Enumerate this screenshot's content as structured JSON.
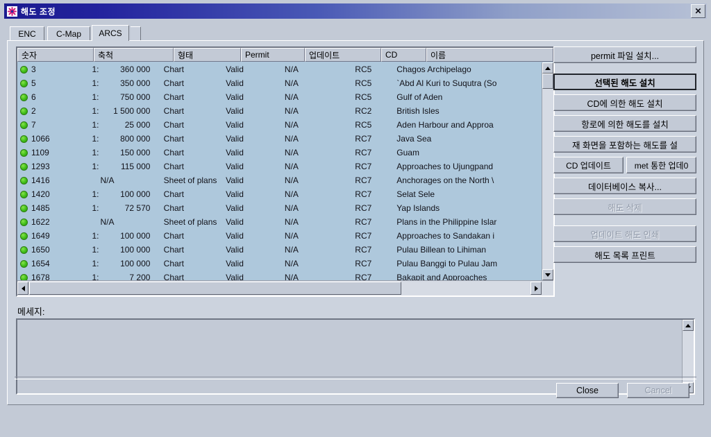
{
  "window": {
    "title": "해도 조정",
    "icon": "app-star-icon",
    "close_label": "✕",
    "titlebar_color": "#1b1b8f"
  },
  "tabs": [
    {
      "label": "ENC",
      "active": false
    },
    {
      "label": "C-Map",
      "active": false
    },
    {
      "label": "ARCS",
      "active": true
    }
  ],
  "table": {
    "columns": [
      {
        "label": "숫자"
      },
      {
        "label": "축척"
      },
      {
        "label": "형태"
      },
      {
        "label": "Permit"
      },
      {
        "label": "업데이트"
      },
      {
        "label": "CD"
      },
      {
        "label": "이름"
      }
    ],
    "rows": [
      {
        "status": "ok",
        "number": "3",
        "scale_ratio": "1:",
        "scale_value": "360 000",
        "type": "Chart",
        "permit": "Valid",
        "update": "N/A",
        "cd": "RC5",
        "name": "Chagos Archipelago"
      },
      {
        "status": "ok",
        "number": "5",
        "scale_ratio": "1:",
        "scale_value": "350 000",
        "type": "Chart",
        "permit": "Valid",
        "update": "N/A",
        "cd": "RC5",
        "name": "`Abd Al Kuri to Suqutra (So"
      },
      {
        "status": "ok",
        "number": "6",
        "scale_ratio": "1:",
        "scale_value": "750 000",
        "type": "Chart",
        "permit": "Valid",
        "update": "N/A",
        "cd": "RC5",
        "name": "Gulf of Aden"
      },
      {
        "status": "ok",
        "number": "2",
        "scale_ratio": "1:",
        "scale_value": "1 500 000",
        "type": "Chart",
        "permit": "Valid",
        "update": "N/A",
        "cd": "RC2",
        "name": "British Isles"
      },
      {
        "status": "ok",
        "number": "7",
        "scale_ratio": "1:",
        "scale_value": "25 000",
        "type": "Chart",
        "permit": "Valid",
        "update": "N/A",
        "cd": "RC5",
        "name": "Aden Harbour and Approa"
      },
      {
        "status": "ok",
        "number": "1066",
        "scale_ratio": "1:",
        "scale_value": "800 000",
        "type": "Chart",
        "permit": "Valid",
        "update": "N/A",
        "cd": "RC7",
        "name": "Java Sea"
      },
      {
        "status": "ok",
        "number": "1109",
        "scale_ratio": "1:",
        "scale_value": "150 000",
        "type": "Chart",
        "permit": "Valid",
        "update": "N/A",
        "cd": "RC7",
        "name": "Guam"
      },
      {
        "status": "ok",
        "number": "1293",
        "scale_ratio": "1:",
        "scale_value": "115 000",
        "type": "Chart",
        "permit": "Valid",
        "update": "N/A",
        "cd": "RC7",
        "name": "Approaches to Ujungpand"
      },
      {
        "status": "ok",
        "number": "1416",
        "scale_ratio": "",
        "scale_value": "N/A",
        "type": "Sheet of plans",
        "permit": "Valid",
        "update": "N/A",
        "cd": "RC7",
        "name": "Anchorages on the North \\"
      },
      {
        "status": "ok",
        "number": "1420",
        "scale_ratio": "1:",
        "scale_value": "100 000",
        "type": "Chart",
        "permit": "Valid",
        "update": "N/A",
        "cd": "RC7",
        "name": "Selat Sele"
      },
      {
        "status": "ok",
        "number": "1485",
        "scale_ratio": "1:",
        "scale_value": "72 570",
        "type": "Chart",
        "permit": "Valid",
        "update": "N/A",
        "cd": "RC7",
        "name": "Yap Islands"
      },
      {
        "status": "ok",
        "number": "1622",
        "scale_ratio": "",
        "scale_value": "N/A",
        "type": "Sheet of plans",
        "permit": "Valid",
        "update": "N/A",
        "cd": "RC7",
        "name": "Plans in the Philippine Islar"
      },
      {
        "status": "ok",
        "number": "1649",
        "scale_ratio": "1:",
        "scale_value": "100 000",
        "type": "Chart",
        "permit": "Valid",
        "update": "N/A",
        "cd": "RC7",
        "name": "Approaches to Sandakan i"
      },
      {
        "status": "ok",
        "number": "1650",
        "scale_ratio": "1:",
        "scale_value": "100 000",
        "type": "Chart",
        "permit": "Valid",
        "update": "N/A",
        "cd": "RC7",
        "name": "Pulau Billean to Lihiman"
      },
      {
        "status": "ok",
        "number": "1654",
        "scale_ratio": "1:",
        "scale_value": "100 000",
        "type": "Chart",
        "permit": "Valid",
        "update": "N/A",
        "cd": "RC7",
        "name": "Pulau Banggi to Pulau Jam"
      },
      {
        "status": "ok",
        "number": "1678",
        "scale_ratio": "1:",
        "scale_value": "7 200",
        "type": "Chart",
        "permit": "Valid",
        "update": "N/A",
        "cd": "RC7",
        "name": "Bakapit and Approaches"
      }
    ]
  },
  "actions": {
    "install_permit_file": "permit 파일 설치...",
    "install_selected_chart": "선택된 해도 설치",
    "install_chart_by_cd": "CD에 의한 해도 설치",
    "install_chart_by_route": "항로에 의한 해도를 설치",
    "install_chart_covering_screen": "재 화면을 포함하는 해도를 설",
    "update_by_cd": "CD 업데이트",
    "update_via_internet": "met 통한 업데0",
    "copy_database": "데이터베이스 복사...",
    "delete_chart": "해도 삭제",
    "print_updated_chart": "업데이트 해도 인쇄",
    "print_chart_list": "해도 목록 프린트"
  },
  "message": {
    "label": "메세지:",
    "value": ""
  },
  "footer": {
    "close": "Close",
    "cancel": "Cancel"
  },
  "scrollbars": {
    "up_arrow": "▲",
    "down_arrow": "▼",
    "left_arrow": "◀",
    "right_arrow": "▶"
  }
}
